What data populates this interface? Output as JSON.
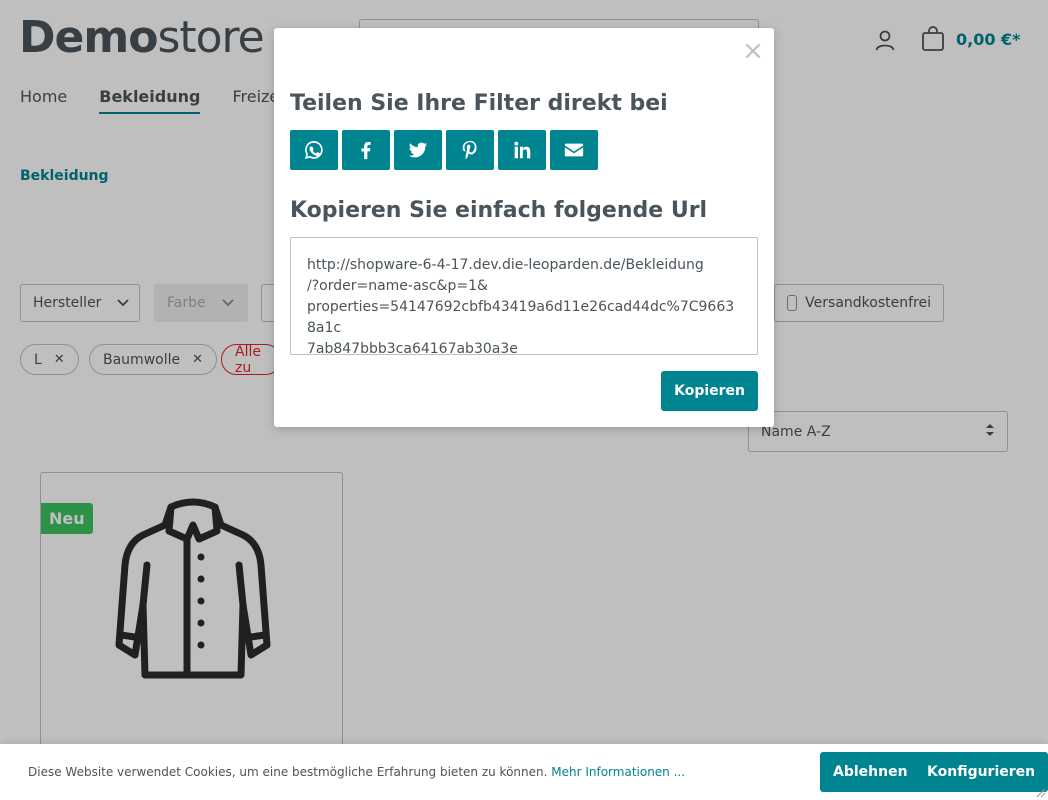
{
  "header": {
    "logo_bold": "Demo",
    "logo_light": "store",
    "cart_total": "0,00 €*"
  },
  "nav": {
    "items": [
      {
        "label": "Home"
      },
      {
        "label": "Bekleidung"
      },
      {
        "label": "Freizeit"
      }
    ]
  },
  "breadcrumb": "Bekleidung",
  "filters": {
    "manufacturer": "Hersteller",
    "color": "Farbe",
    "free_shipping": "Versandkostenfrei"
  },
  "active_filters": {
    "chips": [
      "L",
      "Baumwolle"
    ],
    "reset_label": "Alle zu"
  },
  "sort": {
    "selected": "Name A-Z"
  },
  "product": {
    "badge": "Neu"
  },
  "modal": {
    "title": "Teilen Sie Ihre Filter direkt bei",
    "share_buttons": [
      "whatsapp",
      "facebook",
      "twitter",
      "pinterest",
      "linkedin",
      "email"
    ],
    "subtitle": "Kopieren Sie einfach folgende Url",
    "url": "http://shopware-6-4-17.dev.die-leoparden.de/Bekleidung\n/?order=name-asc&p=1&\nproperties=54147692cbfb43419a6d11e26cad44dc%7C96638a1c\n7ab847bbb3ca64167ab30a3e",
    "copy_label": "Kopieren",
    "close_symbol": "×"
  },
  "cookie": {
    "text": "Diese Website verwendet Cookies, um eine bestmögliche Erfahrung bieten zu können.",
    "link": "Mehr Informationen ...",
    "decline_label": "Ablehnen",
    "configure_label": "Konfigurieren"
  },
  "colors": {
    "primary": "#008490",
    "text": "#4a545b",
    "badge_new": "#3cc261",
    "danger": "#e52427"
  }
}
